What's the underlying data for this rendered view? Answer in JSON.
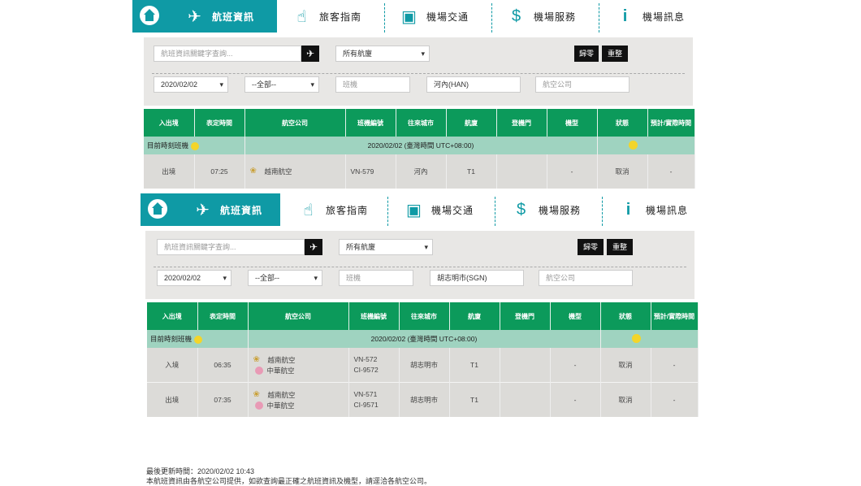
{
  "nav": {
    "items": [
      {
        "label": "航班資訊",
        "icon": "airplane-icon"
      },
      {
        "label": "旅客指南",
        "icon": "hand-pointer-icon"
      },
      {
        "label": "機場交通",
        "icon": "bus-icon"
      },
      {
        "label": "機場服務",
        "icon": "shopping-bag-icon"
      },
      {
        "label": "機場訊息",
        "icon": "info-icon"
      }
    ],
    "home_icon": "home-icon"
  },
  "colors": {
    "teal": "#0f9aa5",
    "green": "#0c9a5b",
    "light_green": "#9fd3c0",
    "row_gray": "#dcdbd8"
  },
  "search": {
    "keyword_placeholder": "航班資訊關鍵字查詢...",
    "go_icon": "airplane-icon",
    "terminal": "所有航廈",
    "clear": "歸零",
    "reset": "重整",
    "airline_placeholder": "航空公司",
    "flight_placeholder": "班機",
    "all_option": "--全部--"
  },
  "headers": [
    "入出境",
    "表定時間",
    "航空公司",
    "班機編號",
    "往來城市",
    "航廈",
    "登機門",
    "機型",
    "狀態",
    "預計/實際時間"
  ],
  "panel1": {
    "date": "2020/02/02",
    "city": "河內(HAN)",
    "now_label": "目前時刻班機",
    "now_time": "2020/02/02 (臺灣時間 UTC+08:00)",
    "rows": [
      {
        "direction": "出境",
        "time": "07:25",
        "airline1": "越南航空",
        "flight1": "VN-579",
        "city": "河內",
        "terminal": "T1",
        "gate": "",
        "type": "-",
        "status": "取消",
        "actual": "-"
      }
    ]
  },
  "panel2": {
    "date": "2020/02/02",
    "city": "胡志明市(SGN)",
    "now_label": "目前時刻班機",
    "now_time": "2020/02/02 (臺灣時間 UTC+08:00)",
    "rows": [
      {
        "direction": "入境",
        "time": "06:35",
        "airline1": "越南航空",
        "airline2": "中華航空",
        "flight1": "VN-572",
        "flight2": "CI-9572",
        "city": "胡志明市",
        "terminal": "T1",
        "gate": "",
        "type": "-",
        "status": "取消",
        "actual": "-"
      },
      {
        "direction": "出境",
        "time": "07:35",
        "airline1": "越南航空",
        "airline2": "中華航空",
        "flight1": "VN-571",
        "flight2": "CI-9571",
        "city": "胡志明市",
        "terminal": "T1",
        "gate": "",
        "type": "-",
        "status": "取消",
        "actual": "-"
      }
    ]
  },
  "footer": {
    "updated": "最後更新時間：2020/02/02 10:43",
    "note": "本航班資訊由各航空公司提供，如欲查詢最正確之航班資訊及機型，請逕洽各航空公司。"
  }
}
